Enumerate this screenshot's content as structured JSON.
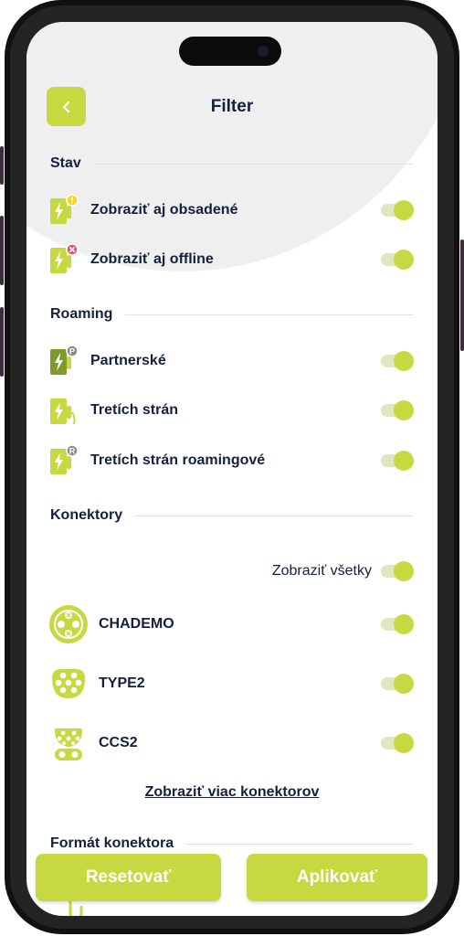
{
  "header": {
    "title": "Filter",
    "back_icon": "chevron-left-icon"
  },
  "sections": {
    "stav": {
      "title": "Stav",
      "items": [
        {
          "label": "Zobraziť aj obsadené",
          "icon": "charger-busy-icon",
          "on": true
        },
        {
          "label": "Zobraziť aj offline",
          "icon": "charger-offline-icon",
          "on": true
        }
      ]
    },
    "roaming": {
      "title": "Roaming",
      "items": [
        {
          "label": "Partnerské",
          "icon": "charger-partner-icon",
          "on": true
        },
        {
          "label": "Tretích strán",
          "icon": "charger-thirdparty-icon",
          "on": true
        },
        {
          "label": "Tretích strán roamingové",
          "icon": "charger-roaming-icon",
          "on": true
        }
      ]
    },
    "konektory": {
      "title": "Konektory",
      "show_all_label": "Zobraziť všetky",
      "items": [
        {
          "label": "CHADEMO",
          "icon": "chademo-connector-icon",
          "on": true
        },
        {
          "label": "TYPE2",
          "icon": "type2-connector-icon",
          "on": true
        },
        {
          "label": "CCS2",
          "icon": "ccs2-connector-icon",
          "on": true
        }
      ],
      "more_link": "Zobraziť viac konektorov"
    },
    "format": {
      "title": "Formát konektora"
    }
  },
  "footer": {
    "reset_label": "Resetovať",
    "apply_label": "Aplikovať"
  },
  "colors": {
    "accent": "#c7d940",
    "text": "#14213d",
    "track": "#e0e6bd",
    "badge_warning": "#f5d327",
    "badge_error": "#e05565",
    "badge_grey": "#8a8a8a"
  }
}
